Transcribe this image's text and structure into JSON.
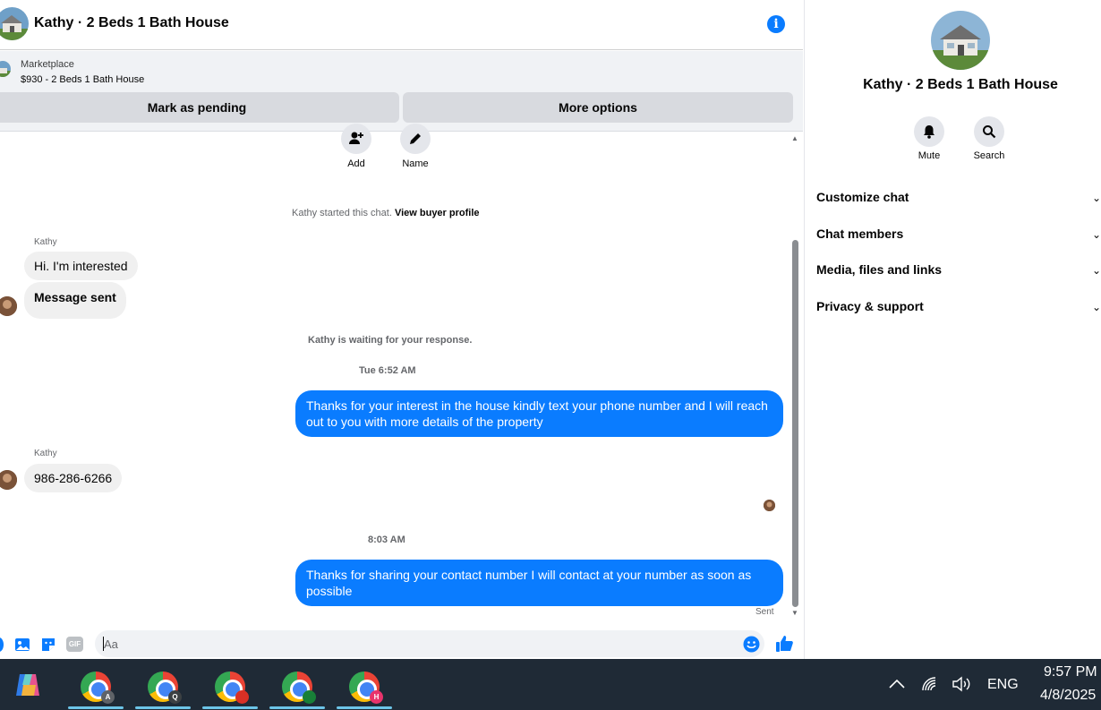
{
  "header": {
    "title": "Kathy · 2 Beds 1 Bath House",
    "info_icon": "info-icon"
  },
  "marketplace": {
    "label": "Marketplace",
    "listing": "$930 - 2 Beds 1 Bath House",
    "pending_label": "Mark as pending",
    "more_label": "More options"
  },
  "chat": {
    "actions": [
      {
        "label": "Add",
        "icon": "add-person-icon"
      },
      {
        "label": "Name",
        "icon": "pencil-icon"
      }
    ],
    "started_text": "Kathy started this chat.",
    "buyer_profile_link": "View buyer profile",
    "messages": {
      "sender1": "Kathy",
      "in1": "Hi. I'm interested",
      "in2": "Message sent",
      "waiting": "Kathy is waiting for your response.",
      "time1": "Tue 6:52 AM",
      "out1": "Thanks for your interest in the house kindly text your phone number and I will reach out to you with more details of the property",
      "sender2": "Kathy",
      "in3": "986-286-6266",
      "time2": "8:03 AM",
      "out2": "Thanks for sharing your contact number I will contact at your number as soon as possible",
      "status": "Sent"
    }
  },
  "composer": {
    "placeholder": "Aa"
  },
  "panel": {
    "title": "Kathy · 2 Beds 1 Bath House",
    "mute_label": "Mute",
    "search_label": "Search",
    "sections": [
      "Customize chat",
      "Chat members",
      "Media, files and links",
      "Privacy & support"
    ]
  },
  "taskbar": {
    "apps": [
      {
        "badge": "A",
        "badge_color": "#5f6368"
      },
      {
        "badge": "Q",
        "badge_color": "#3c4043"
      },
      {
        "badge": "",
        "badge_color": "#d93025"
      },
      {
        "badge": "",
        "badge_color": "#188038"
      },
      {
        "badge": "H",
        "badge_color": "#e8336b"
      }
    ],
    "lang": "ENG",
    "time": "9:57 PM",
    "date": "4/8/2025"
  },
  "colors": {
    "accent": "#0a7cff",
    "taskbar": "#1f2a36"
  }
}
